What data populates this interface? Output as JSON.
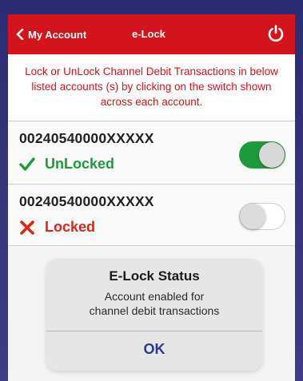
{
  "header": {
    "back_label": "My Account",
    "title": "e-Lock"
  },
  "info": {
    "message": "Lock or UnLock Channel Debit Transactions in below listed accounts (s) by clicking on the switch shown across each account."
  },
  "accounts": [
    {
      "number": "00240540000XXXXX",
      "status": "UnLocked",
      "status_color": "#1e9a3c",
      "toggle_on": true,
      "status_icon": "checkmark-icon"
    },
    {
      "number": "00240540000XXXXX",
      "status": "Locked",
      "status_color": "#e2231a",
      "toggle_on": false,
      "status_icon": "cross-icon"
    }
  ],
  "dialog": {
    "title": "E-Lock Status",
    "message_line1": "Account enabled for",
    "message_line2": "channel debit transactions",
    "ok_label": "OK"
  },
  "colors": {
    "header_bg": "#d3141c",
    "accent_text": "#d3141c",
    "dialog_button": "#2b3a8a"
  }
}
